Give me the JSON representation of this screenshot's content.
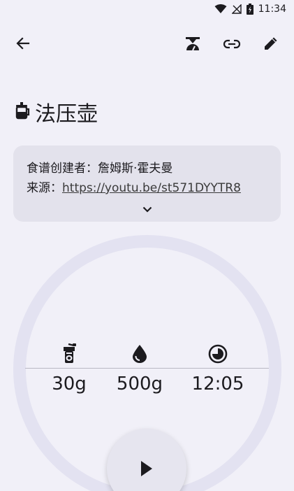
{
  "status_bar": {
    "time": "11:34",
    "icons": [
      "wifi-icon",
      "no-signal-icon",
      "battery-charging-icon"
    ]
  },
  "toolbar": {
    "back_icon": "arrow-back-icon",
    "actions": [
      "scale-icon",
      "link-icon",
      "edit-icon"
    ]
  },
  "recipe": {
    "icon": "french-press-icon",
    "title": "法压壶",
    "creator_label": "食谱创建者：",
    "creator_name": "詹姆斯·霍夫曼",
    "source_label": "来源：",
    "source_url": "https://youtu.be/st571DYYTR8",
    "expand_icon": "chevron-down-icon"
  },
  "stats": {
    "coffee": {
      "icon": "grinder-icon",
      "value": "30g"
    },
    "water": {
      "icon": "water-drop-icon",
      "value": "500g"
    },
    "time": {
      "icon": "timer-icon",
      "value": "12:05"
    }
  },
  "play_icon": "play-icon",
  "colors": {
    "background": "#f1f0f8",
    "card": "#e3e2ec",
    "ring": "#e3e2f1",
    "text": "#1c1b1f"
  }
}
